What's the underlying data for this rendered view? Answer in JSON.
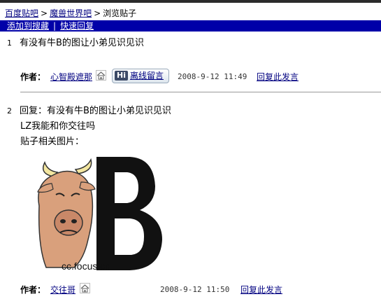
{
  "breadcrumb": {
    "items": [
      "百度贴吧",
      "魔兽世界吧",
      "浏览贴子"
    ],
    "separator": ">"
  },
  "toolbar": {
    "add_favorite": "添加到搜藏",
    "quick_reply": "快速回复",
    "divider": "|"
  },
  "posts": [
    {
      "number": "1",
      "title": "有没有牛B的图让小弟见识见识",
      "author_label": "作者：",
      "author": "心智殿遮那",
      "offline_msg": "离线留言",
      "date": "2008-9-12 11:49",
      "reply": "回复此发言"
    },
    {
      "number": "2",
      "title": "回复：有没有牛B的图让小弟见识见识",
      "body_line": "LZ我能和你交往吗",
      "image_label": "贴子相关图片：",
      "image_text": "cc.focus.cn",
      "author_label": "作者：",
      "author": "交往哥",
      "date": "2008-9-12 11:50",
      "reply": "回复此发言"
    }
  ],
  "colors": {
    "toolbar_bg": "#0000a8",
    "link": "#000080"
  }
}
